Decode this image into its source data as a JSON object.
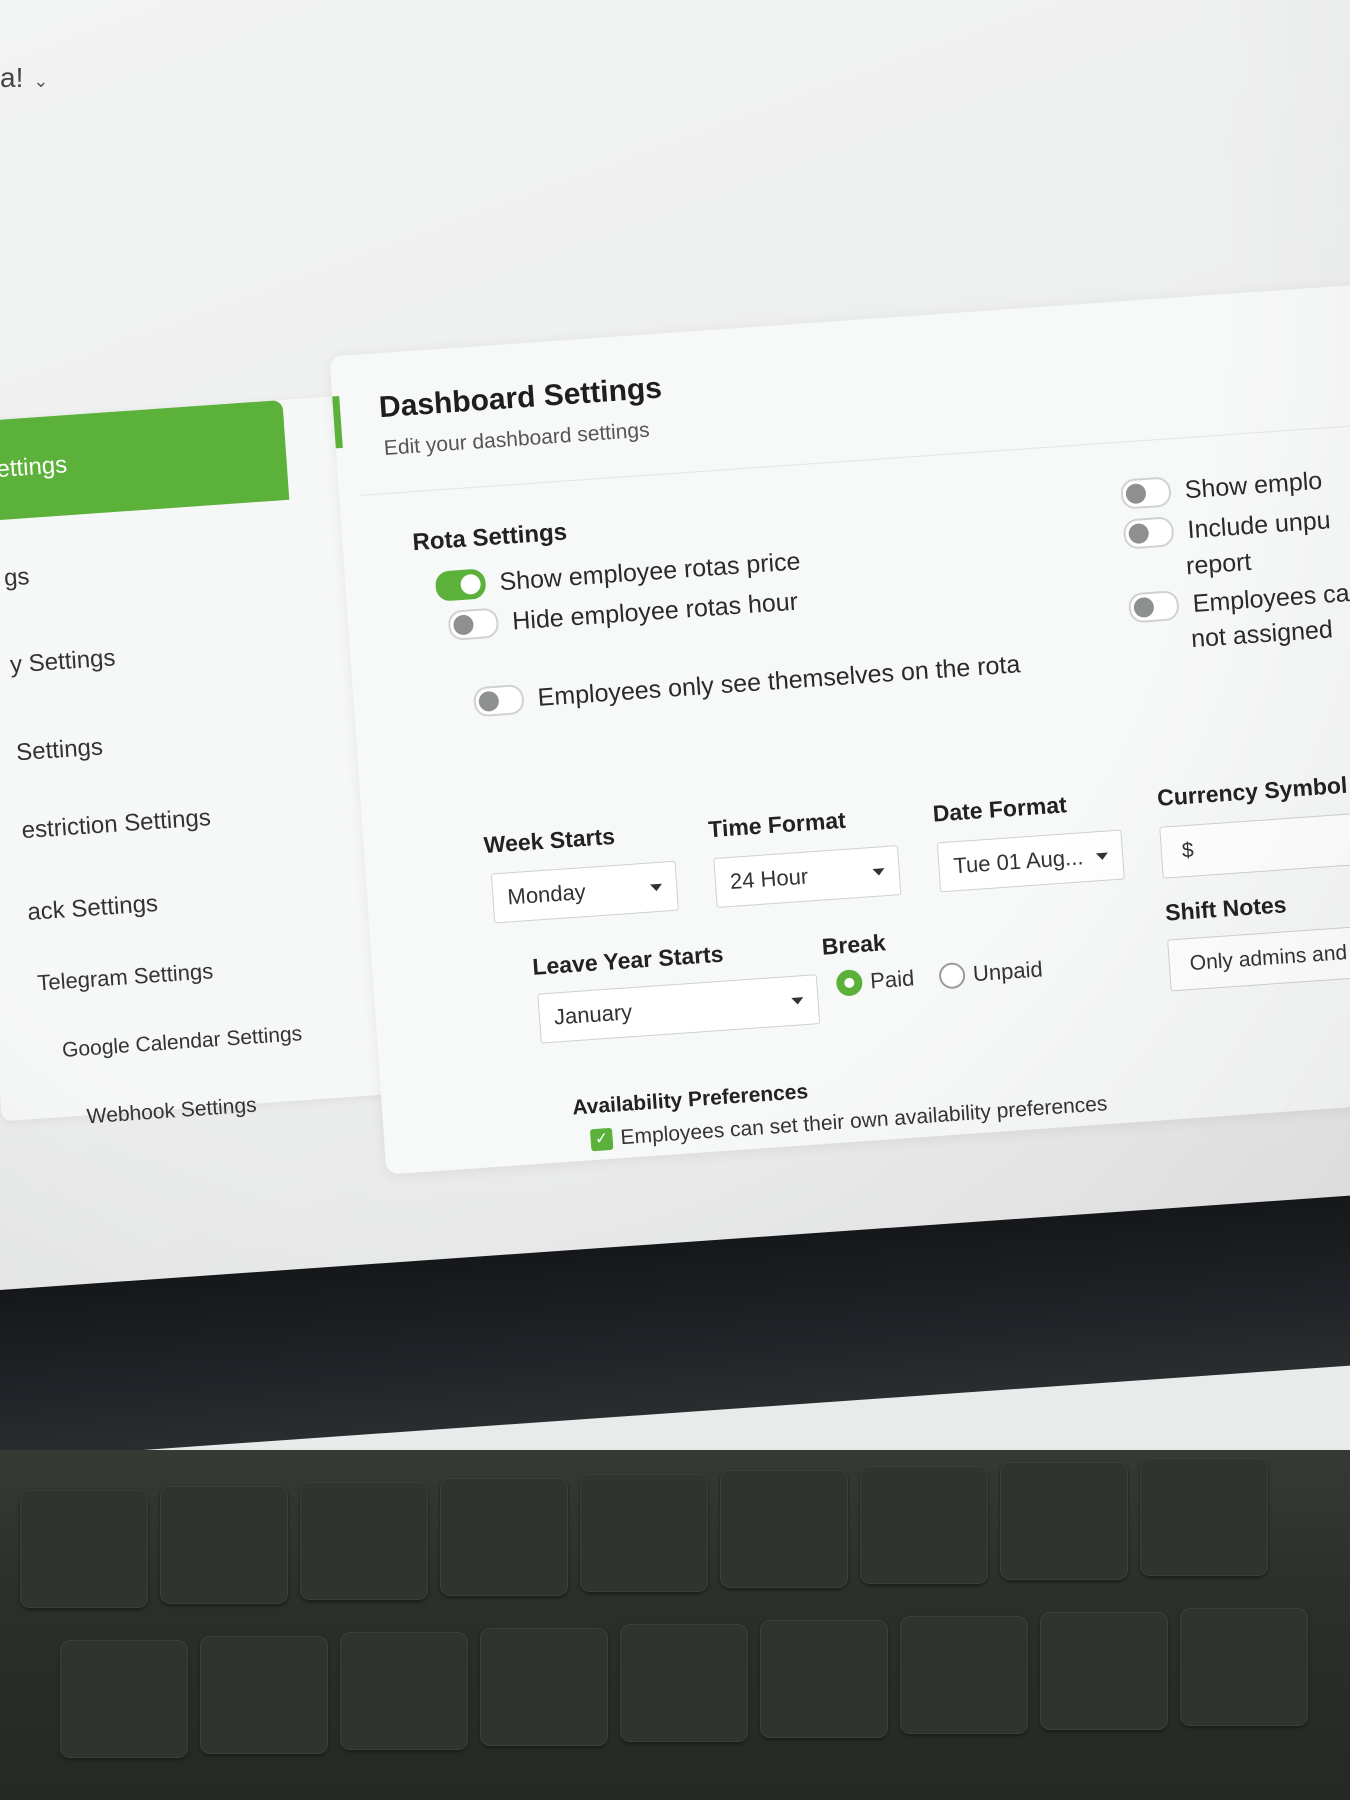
{
  "header": {
    "user_menu_label": "a!"
  },
  "sidebar": {
    "items": [
      {
        "label": "ettings",
        "active": true
      },
      {
        "label": "gs"
      },
      {
        "label": "y Settings"
      },
      {
        "label": "Settings"
      },
      {
        "label": "estriction Settings"
      },
      {
        "label": "ack Settings"
      },
      {
        "label": "Telegram Settings"
      },
      {
        "label": "Google Calendar Settings"
      },
      {
        "label": "Webhook Settings"
      }
    ]
  },
  "panel": {
    "title": "Dashboard Settings",
    "subtitle": "Edit your dashboard settings",
    "rota": {
      "section_title": "Rota Settings",
      "toggles": [
        {
          "label": "Show employee rotas price",
          "on": true
        },
        {
          "label": "Hide employee rotas hour",
          "on": false
        },
        {
          "label": "Employees only see themselves on the rota",
          "on": false
        }
      ]
    },
    "right_toggles": [
      {
        "label": "Show emplo",
        "on": false
      },
      {
        "label": "Include unpu",
        "extra": "report",
        "on": false
      },
      {
        "label": "Employees ca",
        "extra": "not assigned",
        "on": false
      }
    ],
    "week_starts": {
      "label": "Week Starts",
      "value": "Monday"
    },
    "time_format": {
      "label": "Time Format",
      "value": "24 Hour"
    },
    "date_format": {
      "label": "Date Format",
      "value": "Tue 01 Aug..."
    },
    "currency_symbol": {
      "label": "Currency Symbol",
      "value": "$"
    },
    "leave_year_starts": {
      "label": "Leave Year Starts",
      "value": "January"
    },
    "break": {
      "label": "Break",
      "options": [
        "Paid",
        "Unpaid"
      ],
      "selected": "Paid"
    },
    "shift_notes": {
      "label": "Shift Notes",
      "value": "Only admins and ma"
    },
    "availability": {
      "section_title": "Availability Preferences",
      "checkbox_label": "Employees can set their own availability preferences",
      "checked": true
    }
  },
  "colors": {
    "accent": "#5bb139",
    "panel_bg": "#f7f8f8",
    "bezel": "#1b1d20"
  }
}
